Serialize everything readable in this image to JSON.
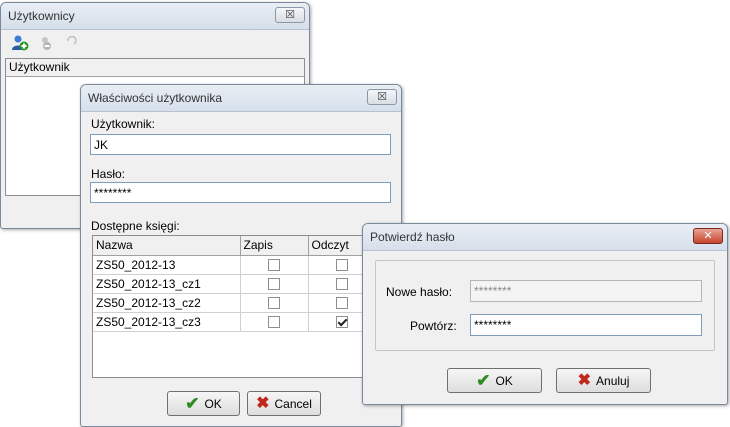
{
  "users_window": {
    "title": "Użytkownicy",
    "close_label": "☒",
    "column_header": "Użytkownik"
  },
  "props_window": {
    "title": "Właściwości użytkownika",
    "close_label": "☒",
    "user_label": "Użytkownik:",
    "user_value": "JK",
    "password_label": "Hasło:",
    "password_value": "********",
    "books_label": "Dostępne księgi:",
    "columns": [
      "Nazwa",
      "Zapis",
      "Odczyt"
    ],
    "books": [
      {
        "name": "ZS50_2012-13",
        "write": false,
        "read": false
      },
      {
        "name": "ZS50_2012-13_cz1",
        "write": false,
        "read": false
      },
      {
        "name": "ZS50_2012-13_cz2",
        "write": false,
        "read": false
      },
      {
        "name": "ZS50_2012-13_cz3",
        "write": false,
        "read": true
      }
    ],
    "ok_label": "OK",
    "cancel_label": "Cancel"
  },
  "confirm_window": {
    "title": "Potwierdź hasło",
    "close_label": "✕",
    "new_password_label": "Nowe hasło:",
    "new_password_value": "********",
    "repeat_label": "Powtórz:",
    "repeat_value": "********",
    "ok_label": "OK",
    "cancel_label": "Anuluj"
  }
}
